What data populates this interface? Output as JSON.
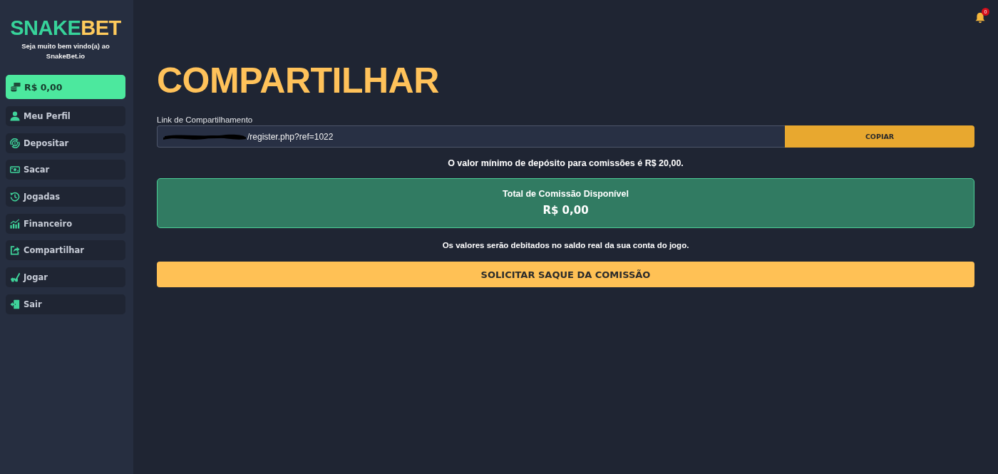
{
  "sidebar": {
    "logo": [
      "SNAKE",
      "BET"
    ],
    "welcome": "Seja muito bem vindo(a) ao SnakeBet.io",
    "balance": "R$ 0,00",
    "items": [
      {
        "label": "Meu Perfil"
      },
      {
        "label": "Depositar"
      },
      {
        "label": "Sacar"
      },
      {
        "label": "Jogadas"
      },
      {
        "label": "Financeiro"
      },
      {
        "label": "Compartilhar"
      },
      {
        "label": "Jogar"
      },
      {
        "label": "Sair"
      }
    ]
  },
  "header": {
    "notifications": "0"
  },
  "page": {
    "title": "COMPARTILHAR",
    "link": {
      "label": "Link de Compartilhamento",
      "value": "/register.php?ref=1022",
      "redacted": true,
      "button": "COPIAR"
    },
    "min_deposit_note": "O valor mínimo de depósito para comissões é R$ 20,00.",
    "commission": {
      "label": "Total de Comissão Disponível",
      "amount": "R$ 0,00"
    },
    "debit_note": "Os valores serão debitados no saldo real da sua conta do jogo.",
    "withdraw_button": "SOLICITAR SAQUE DA COMISSÃO"
  }
}
